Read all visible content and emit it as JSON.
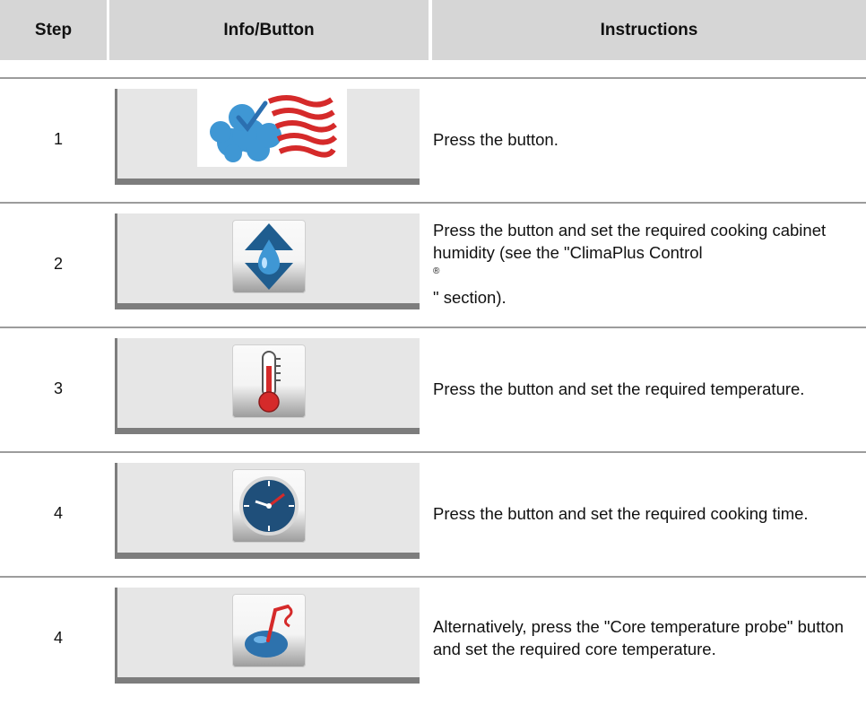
{
  "header": {
    "step": "Step",
    "info": "Info/Button",
    "instructions": "Instructions"
  },
  "rows": [
    {
      "step": "1",
      "icon": "steam-heat-mode-icon",
      "text": "Press the button."
    },
    {
      "step": "2",
      "icon": "humidity-droplet-icon",
      "text_before": "Press the button and set the required cooking cabinet humidity (see the \"ClimaPlus Control",
      "registered": "®",
      "text_after": " \" section)."
    },
    {
      "step": "3",
      "icon": "thermometer-icon",
      "text": "Press the button and set the required temperature."
    },
    {
      "step": "4",
      "icon": "clock-icon",
      "text": "Press the button and set the required cooking time."
    },
    {
      "step": "4",
      "icon": "core-temperature-probe-icon",
      "text": "Alternatively, press the \"Core temperature probe\" button and set the required core temperature."
    }
  ],
  "colors": {
    "header_bg": "#d6d6d6",
    "panel_bg": "#e6e6e6",
    "panel_border": "#7d7d7d",
    "icon_blue": "#3f97d4",
    "icon_red": "#d52a2a"
  }
}
